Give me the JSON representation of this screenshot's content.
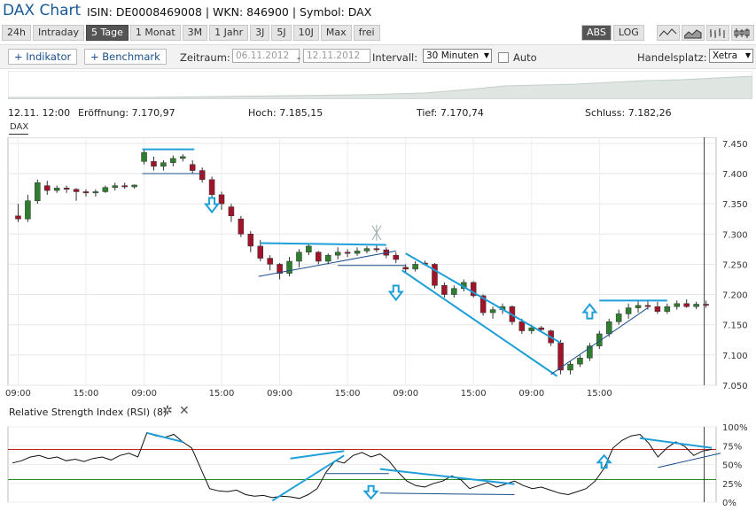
{
  "header": {
    "title": "DAX Chart",
    "meta": "ISIN: DE0008469008 | WKN: 846900 | Symbol: DAX"
  },
  "periods": [
    "24h",
    "Intraday",
    "5 Tage",
    "1 Monat",
    "3M",
    "1 Jahr",
    "3J",
    "5J",
    "10J",
    "Max",
    "frei"
  ],
  "active_period": "5 Tage",
  "modes": [
    "ABS",
    "LOG"
  ],
  "active_mode": "ABS",
  "chart_type_icons": [
    "line-chart-icon",
    "mountain-chart-icon",
    "ohlc-chart-icon",
    "candle-chart-icon",
    "volume-chart-icon"
  ],
  "toolbar": {
    "indikator": "+ Indikator",
    "benchmark": "+ Benchmark",
    "zeitraum_label": "Zeitraum:",
    "date_from": "06.11.2012",
    "date_to": "12.11.2012",
    "dash": "-",
    "intervall_label": "Intervall:",
    "intervall": "30 Minuten",
    "auto_label": "Auto",
    "handelsplatz_label": "Handelsplatz:",
    "handelsplatz": "Xetra"
  },
  "info": {
    "time": "12.11. 12:00",
    "open": "Eröffnung: 7.170,97",
    "high": "Hoch: 7.185,15",
    "low": "Tief: 7.170,74",
    "close": "Schluss: 7.182,26"
  },
  "series_tag": "DAX",
  "rsi_label": "Relative Strength Index (RSI) (8)",
  "colors": {
    "up": "#2f7d2f",
    "down": "#a0142a",
    "annotation": "#1e9fd8",
    "rsi_line": "#111111",
    "rsi_upper": "#c02020",
    "rsi_lower": "#2a8a2a"
  },
  "chart_data": [
    {
      "type": "candlestick",
      "series_name": "DAX",
      "x_tick_labels": [
        "09:00",
        "15:00",
        "09:00",
        "15:00",
        "09:00",
        "15:00",
        "09:00",
        "15:00",
        "09:00",
        "15:00"
      ],
      "y_ticks": [
        "7.450",
        "7.400",
        "7.350",
        "7.300",
        "7.250",
        "7.200",
        "7.150",
        "7.100",
        "7.050"
      ],
      "ylim": [
        7050,
        7460
      ],
      "candles": [
        [
          7330,
          7350,
          7320,
          7325
        ],
        [
          7325,
          7365,
          7320,
          7355
        ],
        [
          7355,
          7390,
          7350,
          7385
        ],
        [
          7380,
          7388,
          7365,
          7372
        ],
        [
          7372,
          7380,
          7368,
          7376
        ],
        [
          7376,
          7380,
          7368,
          7374
        ],
        [
          7374,
          7376,
          7355,
          7370
        ],
        [
          7370,
          7374,
          7362,
          7368
        ],
        [
          7368,
          7374,
          7362,
          7370
        ],
        [
          7370,
          7380,
          7368,
          7377
        ],
        [
          7377,
          7385,
          7372,
          7380
        ],
        [
          7380,
          7385,
          7375,
          7378
        ],
        [
          7378,
          7382,
          7375,
          7381
        ],
        [
          7420,
          7440,
          7415,
          7435
        ],
        [
          7420,
          7428,
          7405,
          7412
        ],
        [
          7412,
          7422,
          7405,
          7418
        ],
        [
          7418,
          7430,
          7412,
          7425
        ],
        [
          7425,
          7432,
          7420,
          7428
        ],
        [
          7415,
          7422,
          7400,
          7405
        ],
        [
          7405,
          7410,
          7385,
          7390
        ],
        [
          7390,
          7395,
          7360,
          7365
        ],
        [
          7365,
          7370,
          7340,
          7350
        ],
        [
          7345,
          7350,
          7320,
          7330
        ],
        [
          7325,
          7330,
          7295,
          7300
        ],
        [
          7300,
          7305,
          7270,
          7280
        ],
        [
          7280,
          7290,
          7255,
          7260
        ],
        [
          7260,
          7265,
          7240,
          7250
        ],
        [
          7250,
          7252,
          7225,
          7235
        ],
        [
          7235,
          7262,
          7230,
          7255
        ],
        [
          7255,
          7275,
          7245,
          7270
        ],
        [
          7270,
          7285,
          7265,
          7280
        ],
        [
          7270,
          7272,
          7250,
          7255
        ],
        [
          7255,
          7268,
          7250,
          7265
        ],
        [
          7265,
          7278,
          7258,
          7270
        ],
        [
          7270,
          7275,
          7262,
          7268
        ],
        [
          7268,
          7278,
          7264,
          7272
        ],
        [
          7272,
          7280,
          7268,
          7276
        ],
        [
          7276,
          7282,
          7270,
          7274
        ],
        [
          7274,
          7278,
          7260,
          7265
        ],
        [
          7265,
          7270,
          7252,
          7258
        ],
        [
          7245,
          7250,
          7235,
          7242
        ],
        [
          7242,
          7255,
          7238,
          7250
        ],
        [
          7252,
          7256,
          7248,
          7250
        ],
        [
          7250,
          7252,
          7210,
          7215
        ],
        [
          7215,
          7220,
          7195,
          7200
        ],
        [
          7200,
          7215,
          7195,
          7210
        ],
        [
          7210,
          7225,
          7205,
          7220
        ],
        [
          7220,
          7222,
          7195,
          7198
        ],
        [
          7198,
          7200,
          7165,
          7170
        ],
        [
          7170,
          7180,
          7160,
          7175
        ],
        [
          7175,
          7185,
          7168,
          7180
        ],
        [
          7180,
          7182,
          7150,
          7155
        ],
        [
          7155,
          7160,
          7135,
          7140
        ],
        [
          7140,
          7150,
          7135,
          7145
        ],
        [
          7145,
          7148,
          7138,
          7142
        ],
        [
          7140,
          7142,
          7115,
          7120
        ],
        [
          7120,
          7125,
          7068,
          7075
        ],
        [
          7075,
          7090,
          7068,
          7085
        ],
        [
          7085,
          7100,
          7080,
          7095
        ],
        [
          7095,
          7120,
          7090,
          7115
        ],
        [
          7115,
          7140,
          7110,
          7135
        ],
        [
          7135,
          7160,
          7130,
          7155
        ],
        [
          7155,
          7175,
          7150,
          7168
        ],
        [
          7168,
          7185,
          7160,
          7178
        ],
        [
          7178,
          7190,
          7170,
          7182
        ],
        [
          7182,
          7190,
          7175,
          7180
        ],
        [
          7180,
          7188,
          7168,
          7172
        ],
        [
          7172,
          7185,
          7168,
          7180
        ],
        [
          7180,
          7190,
          7175,
          7185
        ],
        [
          7185,
          7192,
          7178,
          7180
        ],
        [
          7180,
          7188,
          7176,
          7184
        ],
        [
          7184,
          7190,
          7178,
          7182
        ]
      ]
    },
    {
      "type": "line",
      "series_name": "Relative Strength Index (RSI) (8)",
      "y_ticks": [
        "100%",
        "75%",
        "50%",
        "25%",
        "0%"
      ],
      "ylim": [
        0,
        100
      ],
      "reference_lines": [
        70,
        30
      ],
      "values": [
        52,
        55,
        60,
        62,
        58,
        60,
        55,
        57,
        54,
        58,
        60,
        56,
        62,
        65,
        60,
        92,
        88,
        86,
        90,
        80,
        72,
        45,
        18,
        15,
        14,
        16,
        10,
        8,
        9,
        6,
        8,
        7,
        5,
        10,
        18,
        40,
        55,
        52,
        62,
        66,
        60,
        64,
        55,
        40,
        28,
        22,
        20,
        25,
        28,
        35,
        30,
        18,
        22,
        26,
        20,
        24,
        28,
        22,
        18,
        20,
        16,
        12,
        10,
        14,
        18,
        28,
        45,
        72,
        82,
        88,
        90,
        78,
        60,
        72,
        80,
        74,
        62,
        68,
        70
      ]
    }
  ]
}
